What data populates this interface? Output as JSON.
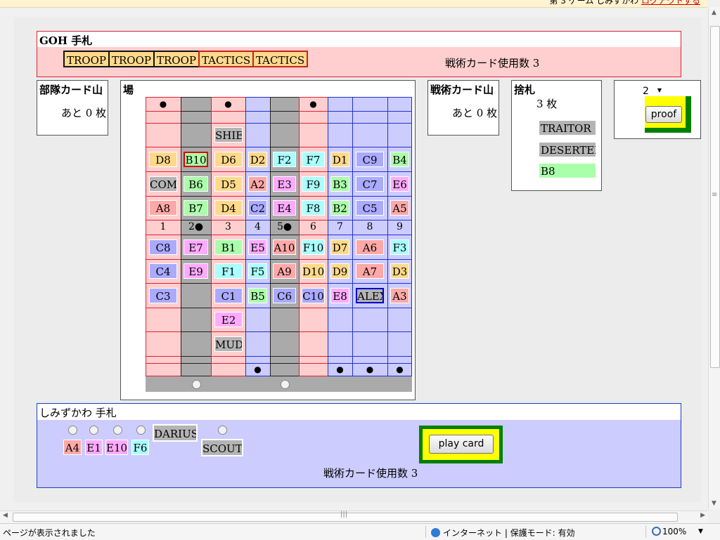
{
  "topbar": {
    "text": "第 3 ゲーム  しみずかわ",
    "logout": "ログアウトする"
  },
  "opponent_hand": {
    "title": "GOH 手札",
    "cards": [
      {
        "label": "TROOP",
        "kind": "troop"
      },
      {
        "label": "TROOP",
        "kind": "troop"
      },
      {
        "label": "TROOP",
        "kind": "troop"
      },
      {
        "label": "TACTICS",
        "kind": "tactics"
      },
      {
        "label": "TACTICS",
        "kind": "tactics"
      }
    ],
    "tactics_used": "戦術カード使用数 3"
  },
  "troop_deck": {
    "title": "部隊カード山",
    "remaining": "あと 0 枚"
  },
  "tactics_deck": {
    "title": "戦術カード山",
    "remaining": "あと 0 枚"
  },
  "field": {
    "title": "場"
  },
  "discard": {
    "title": "捨札",
    "count": "3 枚",
    "cards": [
      "TRAITOR",
      "DESERTER",
      "B8"
    ]
  },
  "proof": {
    "select_value": "2",
    "button_label": "proof"
  },
  "board": {
    "top_markers": [
      "●",
      "",
      "●",
      "",
      "",
      "●",
      "",
      "",
      ""
    ],
    "bottom_markers": [
      "",
      "",
      "",
      "●",
      "",
      "",
      "●",
      "●",
      "●"
    ],
    "flag_numbers": [
      "1",
      "2●",
      "3",
      "4",
      "5●",
      "6",
      "7",
      "8",
      "9"
    ],
    "opponent_rows": [
      [
        "",
        "",
        "",
        "",
        "",
        "",
        "",
        "",
        ""
      ],
      [
        "",
        "",
        "SHIELD",
        "",
        "",
        "",
        "",
        "",
        ""
      ],
      [
        "D8",
        "B10",
        "D6",
        "D2",
        "F2",
        "F7",
        "D1",
        "C9",
        "B4"
      ],
      [
        "COM",
        "B6",
        "D5",
        "A2",
        "E3",
        "F9",
        "B3",
        "C7",
        "E6"
      ],
      [
        "A8",
        "B7",
        "D4",
        "C2",
        "E4",
        "F8",
        "B2",
        "C5",
        "A5"
      ]
    ],
    "my_rows": [
      [
        "C8",
        "E7",
        "B1",
        "E5",
        "A10",
        "F10",
        "D7",
        "A6",
        "F3"
      ],
      [
        "C4",
        "E9",
        "F1",
        "F5",
        "A9",
        "D10",
        "D9",
        "A7",
        "D3"
      ],
      [
        "C3",
        "",
        "C1",
        "B5",
        "C6",
        "C10",
        "E8",
        "ALEX",
        "A3"
      ],
      [
        "",
        "",
        "E2",
        "",
        "",
        "",
        "",
        "",
        ""
      ],
      [
        "",
        "",
        "MUD",
        "",
        "",
        "",
        "",
        "",
        ""
      ],
      [
        "",
        "",
        "",
        "",
        "",
        "",
        "",
        "",
        ""
      ]
    ],
    "column_states": [
      "red",
      "gray",
      "red",
      "blue",
      "gray",
      "red",
      "blue",
      "blue",
      "blue"
    ],
    "bottom_radios": [
      "",
      "○",
      "",
      "",
      "○",
      "",
      "",
      "",
      ""
    ]
  },
  "my_hand": {
    "title": "しみずかわ 手札",
    "cards": [
      "A4",
      "E1",
      "E10",
      "F6"
    ],
    "tactics_cards": [
      "DARIUS",
      "SCOUT"
    ],
    "play_button": "play card",
    "tactics_used": "戦術カード使用数 3"
  },
  "statusbar": {
    "message": "ページが表示されました",
    "zone": "インターネット | 保護モード: 有効",
    "zoom": "100%"
  },
  "colors": {
    "red_column": "#ffcece",
    "blue_column": "#ccccff",
    "gray_column": "#aaaaaa",
    "highlight_yellow": "#ffff00",
    "highlight_green": "#008000"
  }
}
